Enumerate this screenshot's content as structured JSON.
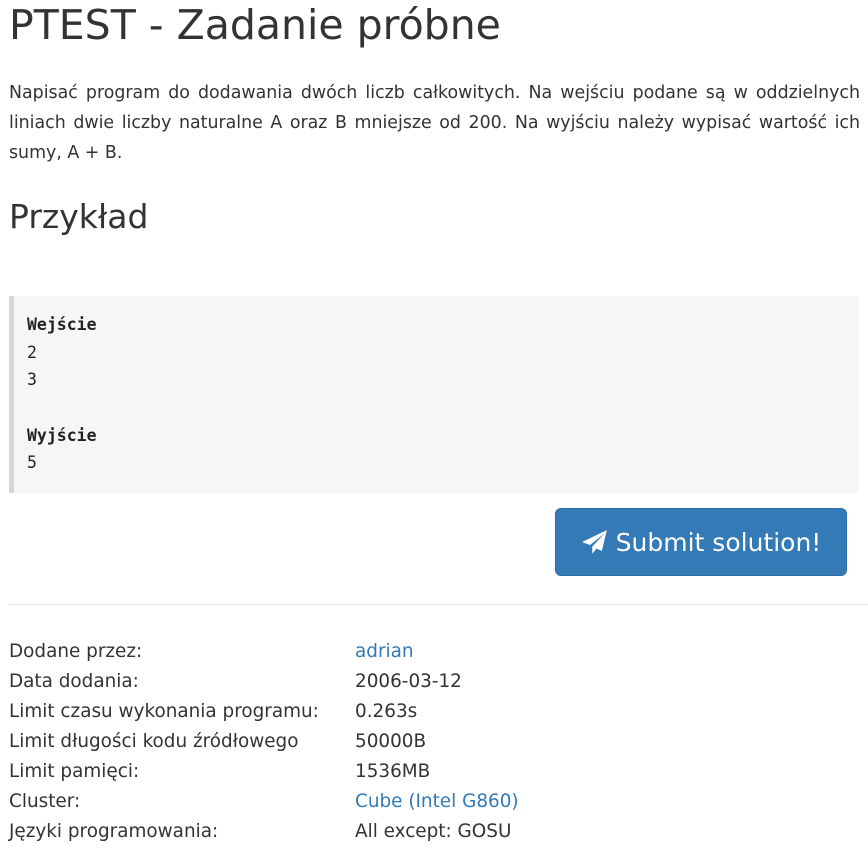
{
  "title": "PTEST - Zadanie próbne",
  "description": "Napisać program do dodawania dwóch liczb całkowitych. Na wejściu podane są w oddzielnych liniach dwie liczby naturalne A oraz B mniejsze od 200. Na wyjściu należy wypisać wartość ich sumy, A + B.",
  "example": {
    "heading": "Przykład",
    "input_label": "Wejście",
    "input_lines": [
      "2",
      "3"
    ],
    "output_label": "Wyjście",
    "output_lines": [
      "5"
    ]
  },
  "submit": {
    "label": "Submit solution!",
    "icon": "paper-plane-icon",
    "color": "#337ab7"
  },
  "info": [
    {
      "label": "Dodane przez:",
      "value": "adrian",
      "link": true
    },
    {
      "label": "Data dodania:",
      "value": "2006-03-12",
      "link": false
    },
    {
      "label": "Limit czasu wykonania programu:",
      "value": "0.263s",
      "link": false
    },
    {
      "label": "Limit długości kodu źródłowego",
      "value": "50000B",
      "link": false
    },
    {
      "label": "Limit pamięci:",
      "value": "1536MB",
      "link": false
    },
    {
      "label": "Cluster:",
      "value": "Cube (Intel G860)",
      "link": true
    },
    {
      "label": "Języki programowania:",
      "value": "All except: GOSU",
      "link": false
    }
  ]
}
